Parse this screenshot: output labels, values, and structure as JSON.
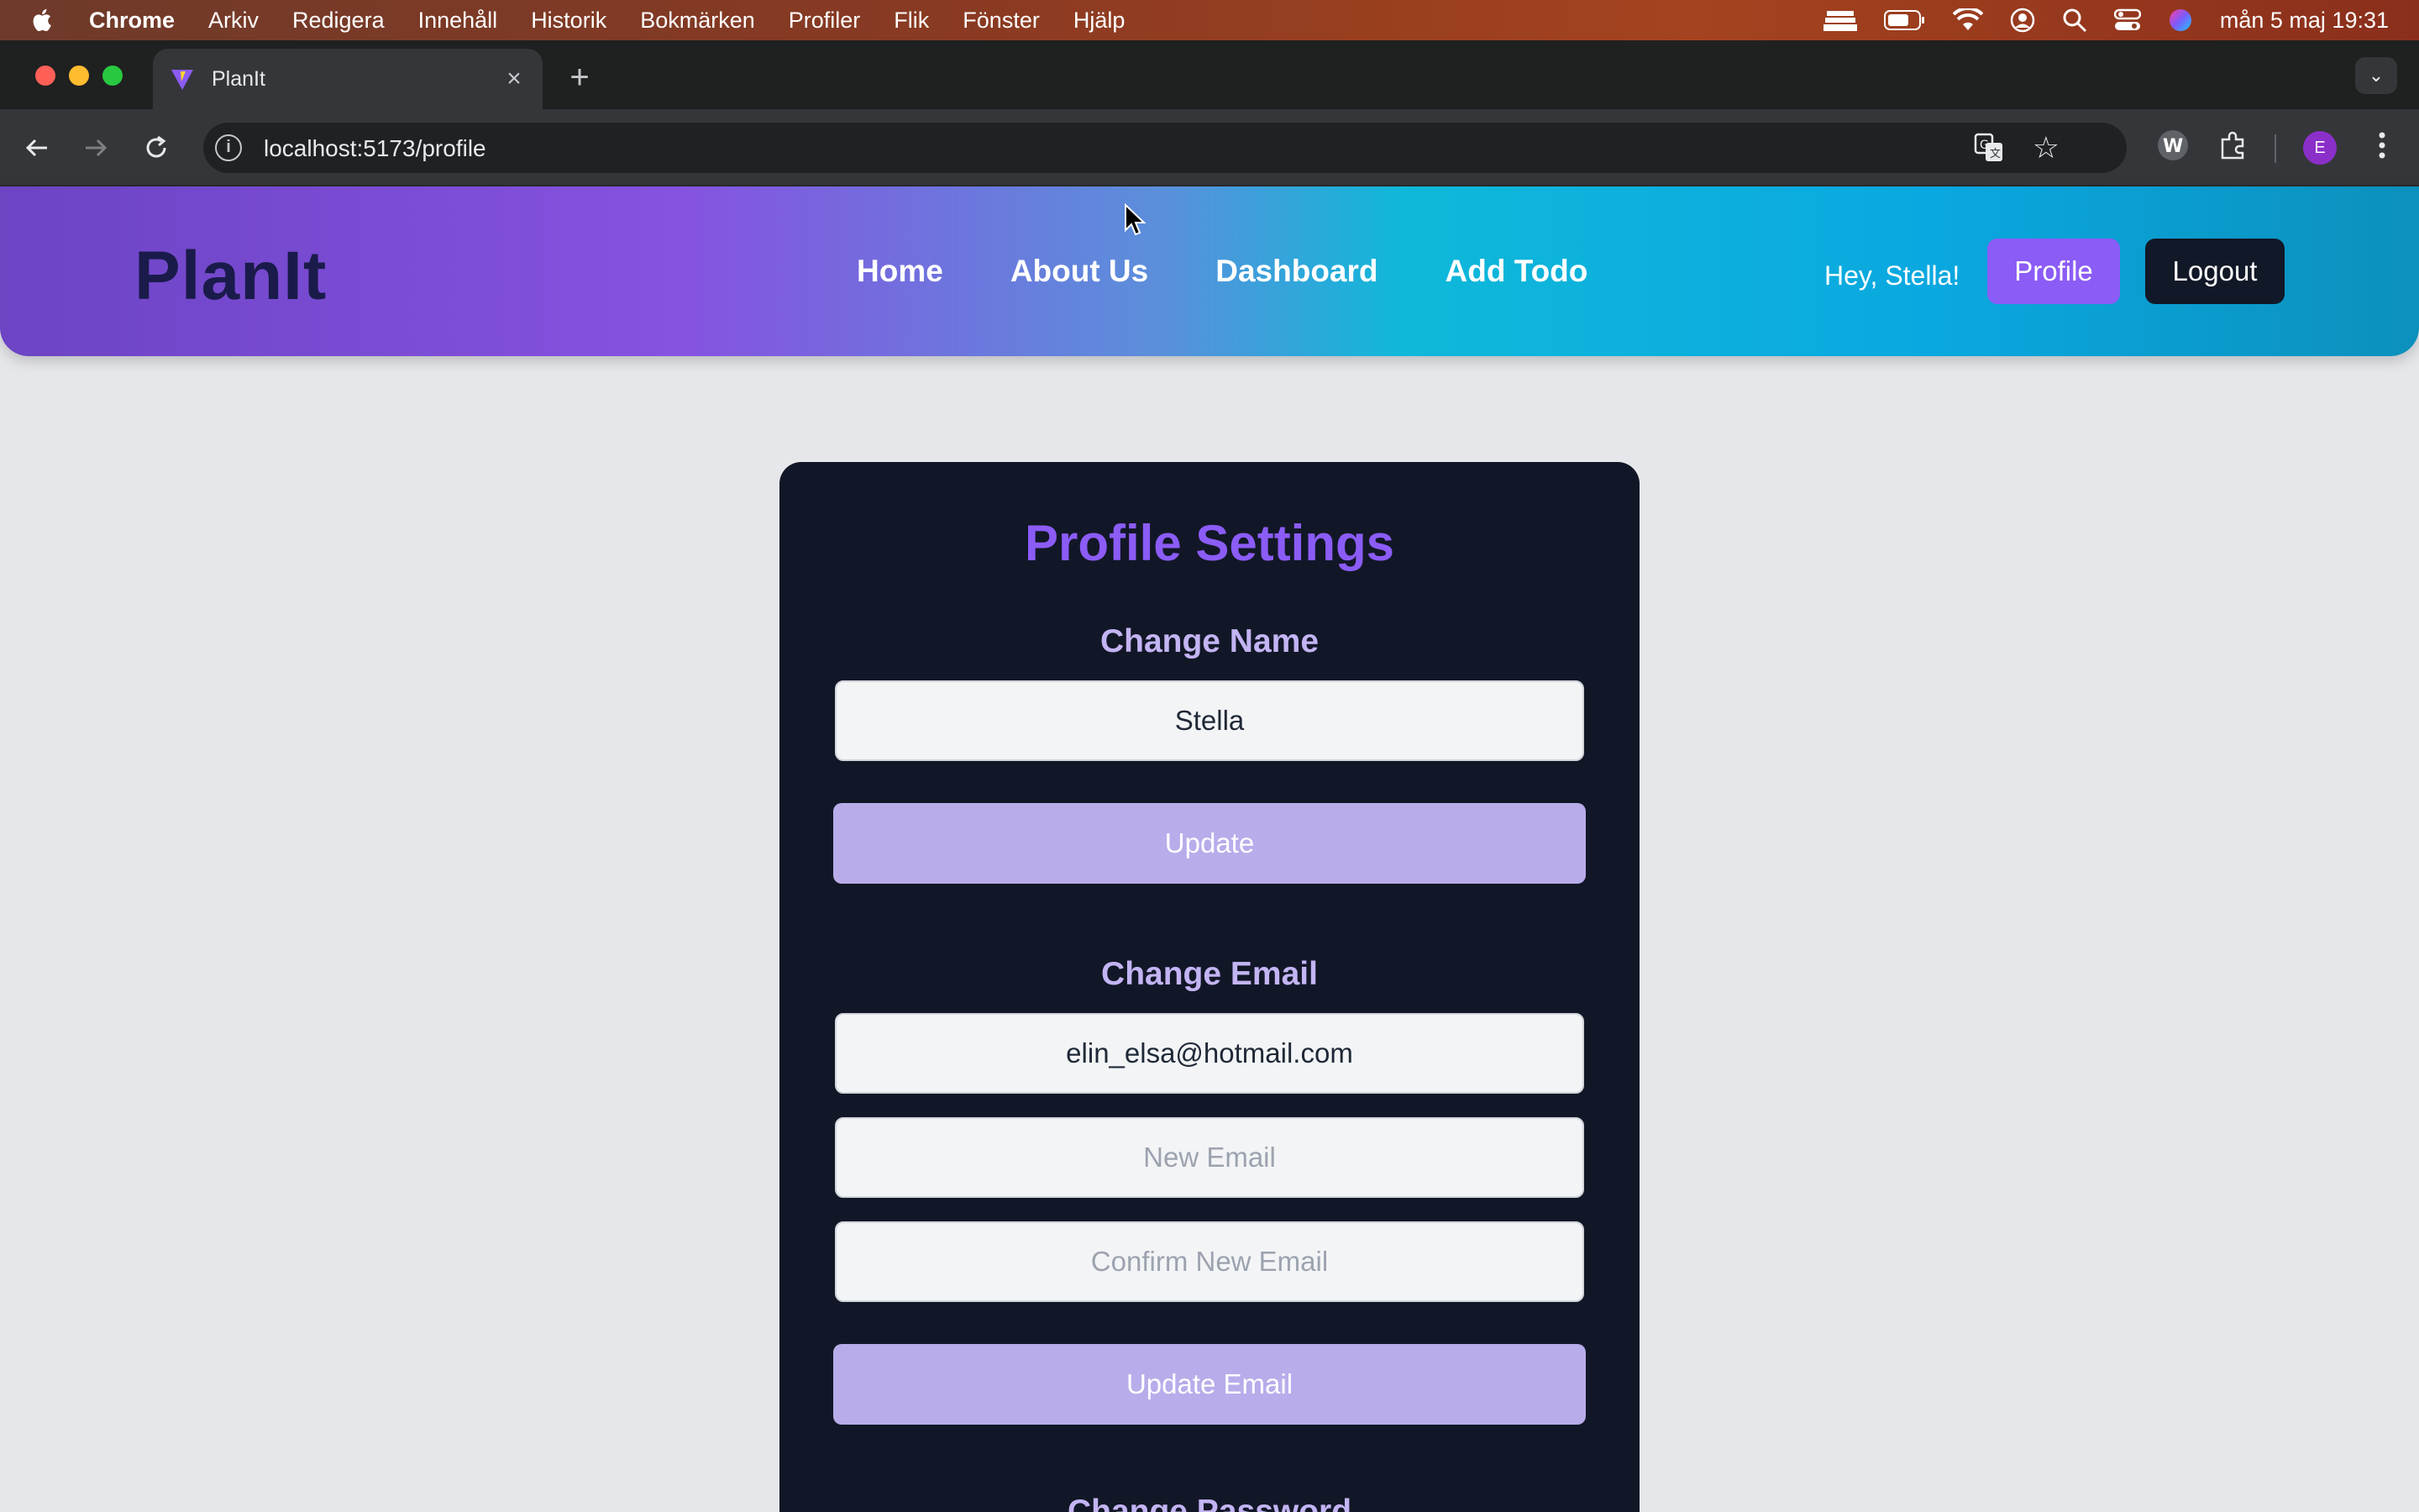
{
  "menubar": {
    "app": "Chrome",
    "items": [
      "Arkiv",
      "Redigera",
      "Innehåll",
      "Historik",
      "Bokmärken",
      "Profiler",
      "Flik",
      "Fönster",
      "Hjälp"
    ],
    "clock": "mån 5 maj 19:31"
  },
  "browser": {
    "tab_title": "PlanIt",
    "url": "localhost:5173/profile",
    "profile_initial": "E"
  },
  "header": {
    "logo": "PlanIt",
    "nav": [
      "Home",
      "About Us",
      "Dashboard",
      "Add Todo"
    ],
    "greeting": "Hey, Stella!",
    "profile_label": "Profile",
    "logout_label": "Logout"
  },
  "card": {
    "title": "Profile Settings",
    "name_section": {
      "title": "Change Name",
      "value": "Stella",
      "button": "Update"
    },
    "email_section": {
      "title": "Change Email",
      "current": "elin_elsa@hotmail.com",
      "new_placeholder": "New Email",
      "confirm_placeholder": "Confirm New Email",
      "button": "Update Email"
    },
    "password_section": {
      "title": "Change Password"
    }
  },
  "colors": {
    "accent": "#8b5cf6",
    "button_muted": "#b8acea",
    "card_bg": "#121727",
    "logo": "#1a1b4b",
    "page_bg": "#e6e7eb"
  }
}
